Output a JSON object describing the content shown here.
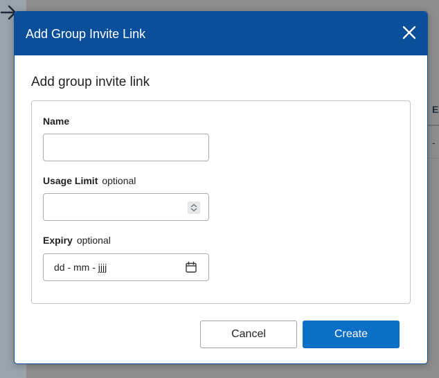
{
  "background": {
    "table_header": "Ex",
    "table_cell": "-"
  },
  "dialog": {
    "title": "Add Group Invite Link",
    "section_title": "Add group invite link",
    "fields": {
      "name": {
        "label": "Name",
        "value": ""
      },
      "usage_limit": {
        "label": "Usage Limit",
        "optional": "optional",
        "value": ""
      },
      "expiry": {
        "label": "Expiry",
        "optional": "optional",
        "placeholder": "dd - mm - jjjj"
      }
    },
    "buttons": {
      "cancel": "Cancel",
      "create": "Create"
    }
  },
  "colors": {
    "header": "#0b4f9a",
    "primary_button": "#0b6fc6"
  },
  "icons": {
    "close": "close-icon",
    "calendar": "calendar-icon",
    "spinner": "spinner-arrows-icon",
    "back": "arrow-right-icon"
  }
}
